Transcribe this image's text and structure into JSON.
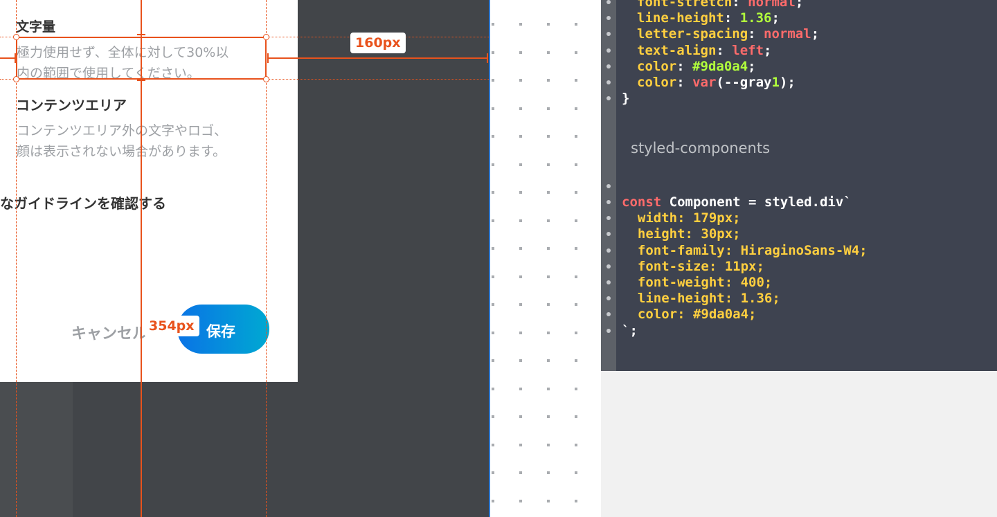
{
  "artboard": {
    "char_count": {
      "heading": "文字量",
      "line1": "極力使用せず、全体に対して30%以",
      "line2": "内の範囲で使用してください。"
    },
    "content_area": {
      "heading": "コンテンツエリア",
      "line1": "コンテンツエリア外の文字やロゴ、",
      "line2": "顔は表示されない場合があります。"
    },
    "guideline_link": "なガイドラインを確認する",
    "cancel_label": "キャンセル",
    "save_label": "保存"
  },
  "measurements": {
    "width_label": "160px",
    "height_label": "354px"
  },
  "code_panel": {
    "css_block": [
      [
        {
          "t": "font-stretch",
          "c": "k-prop"
        },
        {
          "t": ": ",
          "c": "k-white"
        },
        {
          "t": "normal",
          "c": "k-red"
        },
        {
          "t": ";",
          "c": "k-white"
        }
      ],
      [
        {
          "t": "line-height",
          "c": "k-prop"
        },
        {
          "t": ": ",
          "c": "k-white"
        },
        {
          "t": "1.36",
          "c": "k-green"
        },
        {
          "t": ";",
          "c": "k-white"
        }
      ],
      [
        {
          "t": "letter-spacing",
          "c": "k-prop"
        },
        {
          "t": ": ",
          "c": "k-white"
        },
        {
          "t": "normal",
          "c": "k-red"
        },
        {
          "t": ";",
          "c": "k-white"
        }
      ],
      [
        {
          "t": "text-align",
          "c": "k-prop"
        },
        {
          "t": ": ",
          "c": "k-white"
        },
        {
          "t": "left",
          "c": "k-red"
        },
        {
          "t": ";",
          "c": "k-white"
        }
      ],
      [
        {
          "t": "color",
          "c": "k-prop"
        },
        {
          "t": ": ",
          "c": "k-white"
        },
        {
          "t": "#9da0a4",
          "c": "k-green"
        },
        {
          "t": ";",
          "c": "k-white"
        }
      ],
      [
        {
          "t": "color",
          "c": "k-prop"
        },
        {
          "t": ": ",
          "c": "k-white"
        },
        {
          "t": "var",
          "c": "k-red"
        },
        {
          "t": "(--gray",
          "c": "k-white"
        },
        {
          "t": "1",
          "c": "k-green"
        },
        {
          "t": ");",
          "c": "k-white"
        }
      ]
    ],
    "css_close": "}",
    "styled_heading": "styled-components",
    "styled_block": [
      [
        {
          "t": "const",
          "c": "k-red"
        },
        {
          "t": " Component = styled.div`",
          "c": "k-white"
        }
      ],
      [
        {
          "t": "  width: 179px;",
          "c": "k-prop"
        }
      ],
      [
        {
          "t": "  height: 30px;",
          "c": "k-prop"
        }
      ],
      [
        {
          "t": "  font-family: HiraginoSans-W4;",
          "c": "k-prop"
        }
      ],
      [
        {
          "t": "  font-size: 11px;",
          "c": "k-prop"
        }
      ],
      [
        {
          "t": "  font-weight: 400;",
          "c": "k-prop"
        }
      ],
      [
        {
          "t": "  line-height: 1.36;",
          "c": "k-prop"
        }
      ],
      [
        {
          "t": "  color: #9da0a4;",
          "c": "k-prop"
        }
      ],
      [
        {
          "t": "`;",
          "c": "k-white"
        }
      ]
    ]
  },
  "colors": {
    "measure_accent": "#e8521c",
    "save_gradient_start": "#0a73e6",
    "save_gradient_end": "#00a9d2",
    "text_gray": "#9da0a4",
    "code_bg": "#3e4350"
  }
}
